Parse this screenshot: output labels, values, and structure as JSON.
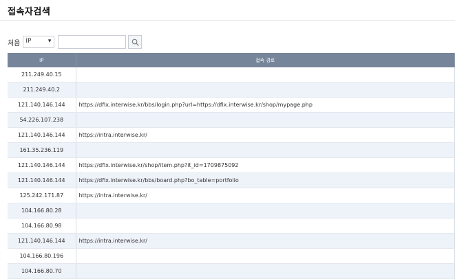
{
  "title": "접속자검색",
  "filter": {
    "label": "처음",
    "field_value": "IP",
    "search_value": ""
  },
  "table": {
    "headers": [
      "IP",
      "접속 경로"
    ],
    "rows": [
      {
        "ip": "211.249.40.15",
        "path": ""
      },
      {
        "ip": "211.249.40.2",
        "path": ""
      },
      {
        "ip": "121.140.146.144",
        "path": "https://dfix.interwise.kr/bbs/login.php?url=https://dfix.interwise.kr/shop/mypage.php"
      },
      {
        "ip": "54.226.107.238",
        "path": ""
      },
      {
        "ip": "121.140.146.144",
        "path": "https://intra.interwise.kr/"
      },
      {
        "ip": "161.35.236.119",
        "path": ""
      },
      {
        "ip": "121.140.146.144",
        "path": "https://dfix.interwise.kr/shop/item.php?it_id=1709875092"
      },
      {
        "ip": "121.140.146.144",
        "path": "https://dfix.interwise.kr/bbs/board.php?bo_table=portfolio"
      },
      {
        "ip": "125.242.171.87",
        "path": "https://intra.interwise.kr/"
      },
      {
        "ip": "104.166.80.28",
        "path": ""
      },
      {
        "ip": "104.166.80.98",
        "path": ""
      },
      {
        "ip": "121.140.146.144",
        "path": "https://intra.interwise.kr/"
      },
      {
        "ip": "104.166.80.196",
        "path": ""
      },
      {
        "ip": "104.166.80.70",
        "path": ""
      }
    ]
  }
}
